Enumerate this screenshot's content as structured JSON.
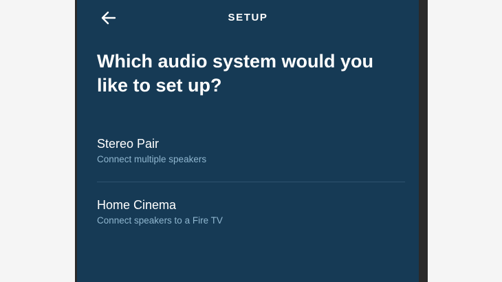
{
  "header": {
    "title": "SETUP",
    "back_icon": "arrow-left-icon"
  },
  "question": "Which audio system would you like to set up?",
  "options": [
    {
      "title": "Stereo Pair",
      "subtitle": "Connect multiple speakers"
    },
    {
      "title": "Home Cinema",
      "subtitle": "Connect speakers to a Fire TV"
    }
  ],
  "colors": {
    "background": "#163a55",
    "accent_text": "#8fb6cf",
    "divider": "#2f5270",
    "frame": "#2a2a2a"
  }
}
